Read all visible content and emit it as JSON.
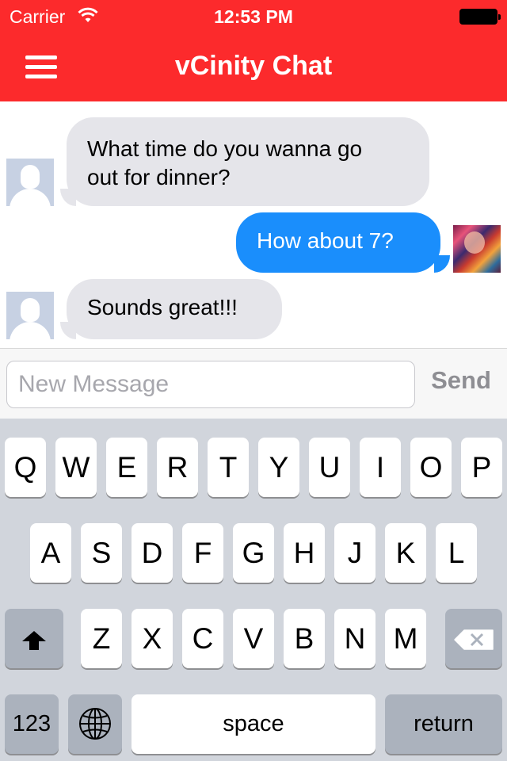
{
  "status_bar": {
    "carrier": "Carrier",
    "time": "12:53 PM"
  },
  "header": {
    "title": "vCinity Chat",
    "menu_icon": "hamburger-menu-icon",
    "background": "#fc2a2c"
  },
  "messages": [
    {
      "direction": "incoming",
      "line1": "What time do you wanna go",
      "line2": "out for dinner?"
    },
    {
      "direction": "outgoing",
      "text": "How about 7?"
    },
    {
      "direction": "incoming",
      "text": "Sounds great!!!"
    }
  ],
  "composer": {
    "placeholder": "New Message",
    "value": "",
    "send_label": "Send"
  },
  "keyboard": {
    "row1": [
      "Q",
      "W",
      "E",
      "R",
      "T",
      "Y",
      "U",
      "I",
      "O",
      "P"
    ],
    "row2": [
      "A",
      "S",
      "D",
      "F",
      "G",
      "H",
      "J",
      "K",
      "L"
    ],
    "row3": [
      "Z",
      "X",
      "C",
      "V",
      "B",
      "N",
      "M"
    ],
    "numbers_label": "123",
    "space_label": "space",
    "return_label": "return",
    "shift_icon": "shift-icon",
    "delete_icon": "backspace-icon",
    "globe_icon": "globe-icon"
  },
  "colors": {
    "incoming_bubble": "#e5e5ea",
    "outgoing_bubble": "#1a8efc",
    "keyboard_bg": "#d1d5dc"
  }
}
